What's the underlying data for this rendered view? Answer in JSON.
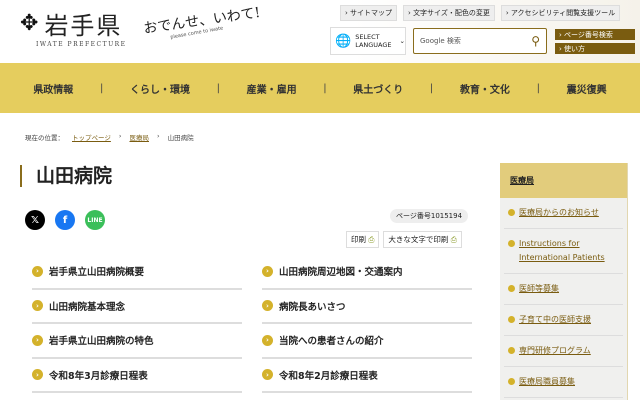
{
  "header": {
    "logo_text": "岩手県",
    "logo_sub": "IWATE PREFECTURE",
    "slogan": "おでんせ、いわて!",
    "slogan_en": "please come to iwate",
    "top_links": [
      "サイトマップ",
      "文字サイズ・配色の変更",
      "アクセシビリティ閲覧支援ツール"
    ],
    "language": "SELECT LANGUAGE",
    "search_placeholder": "Google 検索",
    "page_search": "ページ番号検索",
    "usage": "使い方"
  },
  "nav": [
    "県政情報",
    "くらし・環境",
    "産業・雇用",
    "県土づくり",
    "教育・文化",
    "震災復興"
  ],
  "breadcrumb": {
    "label": "現在の位置：",
    "items": [
      "トップページ",
      "医療局",
      "山田病院"
    ]
  },
  "title": "山田病院",
  "page_number": "ページ番号1015194",
  "print": "印刷",
  "print_large": "大きな文字で印刷",
  "links": [
    "岩手県立山田病院概要",
    "山田病院周辺地図・交通案内",
    "山田病院基本理念",
    "病院長あいさつ",
    "岩手県立山田病院の特色",
    "当院への患者さんの紹介",
    "令和8年3月診療日程表",
    "令和8年2月診療日程表"
  ],
  "sidebar": {
    "heading": "医療局",
    "items": [
      "医療局からのお知らせ",
      "Instructions for International Patients",
      "医師等募集",
      "子育て中の医師支援",
      "専門研修プログラム",
      "医療局職員募集"
    ]
  }
}
